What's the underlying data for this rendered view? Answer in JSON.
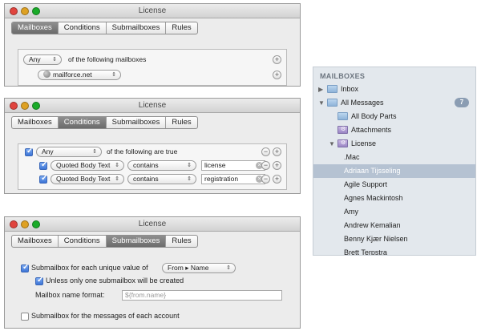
{
  "tabs": [
    "Mailboxes",
    "Conditions",
    "Submailboxes",
    "Rules"
  ],
  "window_a": {
    "title": "License",
    "selected_tab": "Mailboxes",
    "match_popup": "Any",
    "match_text": "of the following mailboxes",
    "mailbox_popup": "mailforce.net"
  },
  "window_b": {
    "title": "License",
    "selected_tab": "Conditions",
    "match_popup": "Any",
    "match_text": "of the following are true",
    "conditions": [
      {
        "field": "Quoted Body Text",
        "operator": "contains",
        "value": "license"
      },
      {
        "field": "Quoted Body Text",
        "operator": "contains",
        "value": "registration"
      }
    ]
  },
  "window_c": {
    "title": "License",
    "selected_tab": "Submailboxes",
    "unique_value_label": "Submailbox for each unique value of",
    "unique_value_popup": "From ▸ Name",
    "unless_label": "Unless only one submailbox will be created",
    "name_format_label": "Mailbox name format:",
    "name_format_placeholder": "${from.name}",
    "account_label": "Submailbox for the messages of each account"
  },
  "sidebar": {
    "header": "MAILBOXES",
    "items": [
      {
        "label": "Inbox",
        "badge": ""
      },
      {
        "label": "All Messages",
        "badge": "7"
      },
      {
        "label": "All Body Parts",
        "badge": ""
      },
      {
        "label": "Attachments",
        "badge": ""
      },
      {
        "label": "License",
        "badge": ""
      },
      {
        "label": ".Mac",
        "badge": ""
      },
      {
        "label": "Adriaan Tijsseling",
        "badge": ""
      },
      {
        "label": "Agile Support",
        "badge": ""
      },
      {
        "label": "Agnes Mackintosh",
        "badge": ""
      },
      {
        "label": "Amy",
        "badge": ""
      },
      {
        "label": "Andrew Kemalian",
        "badge": ""
      },
      {
        "label": "Benny Kjær Nielsen",
        "badge": ""
      },
      {
        "label": "Brett Terpstra",
        "badge": ""
      }
    ]
  }
}
